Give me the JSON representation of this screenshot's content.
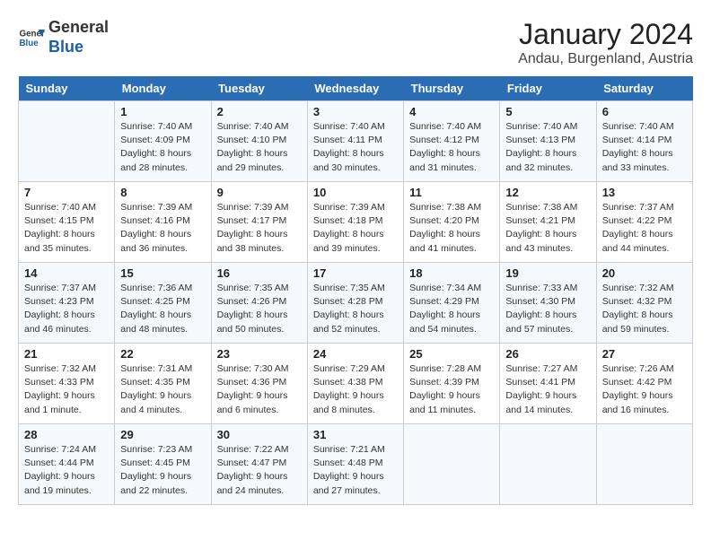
{
  "header": {
    "logo_general": "General",
    "logo_blue": "Blue",
    "month_year": "January 2024",
    "location": "Andau, Burgenland, Austria"
  },
  "days_of_week": [
    "Sunday",
    "Monday",
    "Tuesday",
    "Wednesday",
    "Thursday",
    "Friday",
    "Saturday"
  ],
  "weeks": [
    [
      {
        "day": "",
        "info": ""
      },
      {
        "day": "1",
        "info": "Sunrise: 7:40 AM\nSunset: 4:09 PM\nDaylight: 8 hours\nand 28 minutes."
      },
      {
        "day": "2",
        "info": "Sunrise: 7:40 AM\nSunset: 4:10 PM\nDaylight: 8 hours\nand 29 minutes."
      },
      {
        "day": "3",
        "info": "Sunrise: 7:40 AM\nSunset: 4:11 PM\nDaylight: 8 hours\nand 30 minutes."
      },
      {
        "day": "4",
        "info": "Sunrise: 7:40 AM\nSunset: 4:12 PM\nDaylight: 8 hours\nand 31 minutes."
      },
      {
        "day": "5",
        "info": "Sunrise: 7:40 AM\nSunset: 4:13 PM\nDaylight: 8 hours\nand 32 minutes."
      },
      {
        "day": "6",
        "info": "Sunrise: 7:40 AM\nSunset: 4:14 PM\nDaylight: 8 hours\nand 33 minutes."
      }
    ],
    [
      {
        "day": "7",
        "info": "Sunrise: 7:40 AM\nSunset: 4:15 PM\nDaylight: 8 hours\nand 35 minutes."
      },
      {
        "day": "8",
        "info": "Sunrise: 7:39 AM\nSunset: 4:16 PM\nDaylight: 8 hours\nand 36 minutes."
      },
      {
        "day": "9",
        "info": "Sunrise: 7:39 AM\nSunset: 4:17 PM\nDaylight: 8 hours\nand 38 minutes."
      },
      {
        "day": "10",
        "info": "Sunrise: 7:39 AM\nSunset: 4:18 PM\nDaylight: 8 hours\nand 39 minutes."
      },
      {
        "day": "11",
        "info": "Sunrise: 7:38 AM\nSunset: 4:20 PM\nDaylight: 8 hours\nand 41 minutes."
      },
      {
        "day": "12",
        "info": "Sunrise: 7:38 AM\nSunset: 4:21 PM\nDaylight: 8 hours\nand 43 minutes."
      },
      {
        "day": "13",
        "info": "Sunrise: 7:37 AM\nSunset: 4:22 PM\nDaylight: 8 hours\nand 44 minutes."
      }
    ],
    [
      {
        "day": "14",
        "info": "Sunrise: 7:37 AM\nSunset: 4:23 PM\nDaylight: 8 hours\nand 46 minutes."
      },
      {
        "day": "15",
        "info": "Sunrise: 7:36 AM\nSunset: 4:25 PM\nDaylight: 8 hours\nand 48 minutes."
      },
      {
        "day": "16",
        "info": "Sunrise: 7:35 AM\nSunset: 4:26 PM\nDaylight: 8 hours\nand 50 minutes."
      },
      {
        "day": "17",
        "info": "Sunrise: 7:35 AM\nSunset: 4:28 PM\nDaylight: 8 hours\nand 52 minutes."
      },
      {
        "day": "18",
        "info": "Sunrise: 7:34 AM\nSunset: 4:29 PM\nDaylight: 8 hours\nand 54 minutes."
      },
      {
        "day": "19",
        "info": "Sunrise: 7:33 AM\nSunset: 4:30 PM\nDaylight: 8 hours\nand 57 minutes."
      },
      {
        "day": "20",
        "info": "Sunrise: 7:32 AM\nSunset: 4:32 PM\nDaylight: 8 hours\nand 59 minutes."
      }
    ],
    [
      {
        "day": "21",
        "info": "Sunrise: 7:32 AM\nSunset: 4:33 PM\nDaylight: 9 hours\nand 1 minute."
      },
      {
        "day": "22",
        "info": "Sunrise: 7:31 AM\nSunset: 4:35 PM\nDaylight: 9 hours\nand 4 minutes."
      },
      {
        "day": "23",
        "info": "Sunrise: 7:30 AM\nSunset: 4:36 PM\nDaylight: 9 hours\nand 6 minutes."
      },
      {
        "day": "24",
        "info": "Sunrise: 7:29 AM\nSunset: 4:38 PM\nDaylight: 9 hours\nand 8 minutes."
      },
      {
        "day": "25",
        "info": "Sunrise: 7:28 AM\nSunset: 4:39 PM\nDaylight: 9 hours\nand 11 minutes."
      },
      {
        "day": "26",
        "info": "Sunrise: 7:27 AM\nSunset: 4:41 PM\nDaylight: 9 hours\nand 14 minutes."
      },
      {
        "day": "27",
        "info": "Sunrise: 7:26 AM\nSunset: 4:42 PM\nDaylight: 9 hours\nand 16 minutes."
      }
    ],
    [
      {
        "day": "28",
        "info": "Sunrise: 7:24 AM\nSunset: 4:44 PM\nDaylight: 9 hours\nand 19 minutes."
      },
      {
        "day": "29",
        "info": "Sunrise: 7:23 AM\nSunset: 4:45 PM\nDaylight: 9 hours\nand 22 minutes."
      },
      {
        "day": "30",
        "info": "Sunrise: 7:22 AM\nSunset: 4:47 PM\nDaylight: 9 hours\nand 24 minutes."
      },
      {
        "day": "31",
        "info": "Sunrise: 7:21 AM\nSunset: 4:48 PM\nDaylight: 9 hours\nand 27 minutes."
      },
      {
        "day": "",
        "info": ""
      },
      {
        "day": "",
        "info": ""
      },
      {
        "day": "",
        "info": ""
      }
    ]
  ]
}
